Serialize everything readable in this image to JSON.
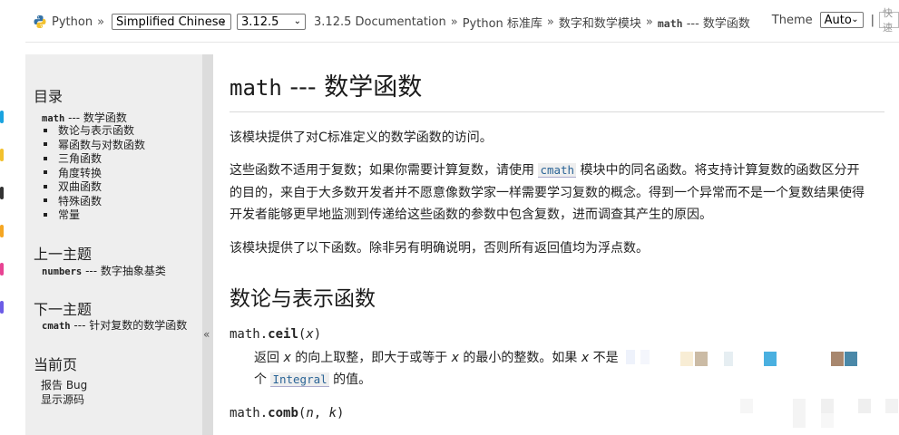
{
  "topbar": {
    "crumb_python": "Python",
    "sep": "»",
    "language_selected": "Simplified Chinese",
    "version_selected": "3.12.5",
    "crumb_doc": "3.12.5 Documentation",
    "crumb_stdlib": "Python 标准库",
    "crumb_numeric": "数字和数学模块",
    "crumb_current_code": "math",
    "crumb_current_text": " --- 数学函数",
    "theme_label": "Theme",
    "theme_selected": "Auto",
    "bar": "|",
    "search_placeholder": "快速"
  },
  "sidebar": {
    "toc_title": "目录",
    "toc_root_code": "math",
    "toc_root_text": " --- 数学函数",
    "toc_items": [
      "数论与表示函数",
      "幂函数与对数函数",
      "三角函数",
      "角度转换",
      "双曲函数",
      "特殊函数",
      "常量"
    ],
    "prev_title": "上一主题",
    "prev_code": "numbers",
    "prev_text": " --- 数字抽象基类",
    "next_title": "下一主题",
    "next_code": "cmath",
    "next_text": " --- 针对复数的数学函数",
    "page_title": "当前页",
    "report_bug": "报告 Bug",
    "show_source": "显示源码",
    "collapse": "«"
  },
  "main": {
    "title_code": "math",
    "title_text": " --- 数学函数",
    "p1": "该模块提供了对C标准定义的数学函数的访问。",
    "p2_a": "这些函数不适用于复数；如果你需要计算复数，请使用 ",
    "p2_ref": "cmath",
    "p2_b": " 模块中的同名函数。将支持计算复数的函数区分开",
    "p2_line2": "的目的，来自于大多数开发者并不愿意像数学家一样需要学习复数的概念。得到一个异常而不是一个复数结果使得",
    "p2_line3": "开发者能够更早地监测到传递给这些函数的参数中包含复数，进而调查其产生的原因。",
    "p3": "该模块提供了以下函数。除非另有明确说明，否则所有返回值均为浮点数。",
    "h2": "数论与表示函数",
    "ceil_prefix": "math.",
    "ceil_name": "ceil",
    "ceil_open": "(",
    "ceil_param": "x",
    "ceil_close": ")",
    "ceil_d1_a": "返回 ",
    "ceil_d1_x1": "x",
    "ceil_d1_b": " 的向上取整，即大于或等于 ",
    "ceil_d1_x2": "x",
    "ceil_d1_c": " 的最小的整数。如果 ",
    "ceil_d1_x3": "x",
    "ceil_d1_d": " 不是",
    "ceil_d2_a": "个 ",
    "ceil_d2_ref": "Integral",
    "ceil_d2_b": " 的值。",
    "comb_prefix": "math.",
    "comb_name": "comb",
    "comb_open": "(",
    "comb_p1": "n",
    "comb_comma": ", ",
    "comb_p2": "k",
    "comb_close": ")"
  }
}
